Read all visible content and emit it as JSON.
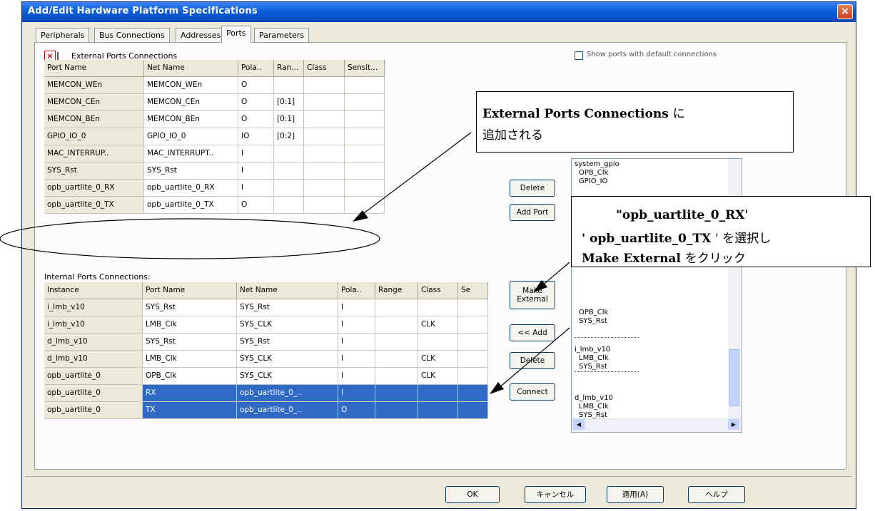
{
  "window": {
    "title": "Add/Edit Hardware Platform Specifications",
    "close_glyph": "×"
  },
  "tabs": [
    "Peripherals",
    "Bus Connections",
    "Addresses",
    "Ports",
    "Parameters"
  ],
  "active_tab": "Ports",
  "external": {
    "label": "External Ports Connections",
    "columns": [
      "Port Name",
      "Net Name",
      "Pola..",
      "Ran...",
      "Class",
      "Sensit..."
    ],
    "rows": [
      [
        "MEMCON_WEn",
        "MEMCON_WEn",
        "O",
        "",
        "",
        ""
      ],
      [
        "MEMCON_CEn",
        "MEMCON_CEn",
        "O",
        "[0:1]",
        "",
        ""
      ],
      [
        "MEMCON_BEn",
        "MEMCON_BEn",
        "O",
        "[0:1]",
        "",
        ""
      ],
      [
        "GPIO_IO_0",
        "GPIO_IO_0",
        "IO",
        "[0:2]",
        "",
        ""
      ],
      [
        "MAC_INTERRUP..",
        "MAC_INTERRUPT..",
        "I",
        "",
        "",
        ""
      ],
      [
        "SYS_Rst",
        "SYS_Rst",
        "I",
        "",
        "",
        ""
      ],
      [
        "opb_uartlite_0_RX",
        "opb_uartlite_0_RX",
        "I",
        "",
        "",
        ""
      ],
      [
        "opb_uartlite_0_TX",
        "opb_uartlite_0_TX",
        "O",
        "",
        "",
        ""
      ]
    ]
  },
  "internal": {
    "label": "Internal Ports Connections:",
    "columns": [
      "Instance",
      "Port Name",
      "Net Name",
      "Pola..",
      "Range",
      "Class",
      "Se"
    ],
    "rows": [
      [
        "i_lmb_v10",
        "SYS_Rst",
        "SYS_Rst",
        "I",
        "",
        ""
      ],
      [
        "i_lmb_v10",
        "LMB_Clk",
        "SYS_CLK",
        "I",
        "",
        "CLK"
      ],
      [
        "d_lmb_v10",
        "SYS_Rst",
        "SYS_Rst",
        "I",
        "",
        ""
      ],
      [
        "d_lmb_v10",
        "LMB_Clk",
        "SYS_CLK",
        "I",
        "",
        "CLK"
      ],
      [
        "opb_uartlite_0",
        "OPB_Clk",
        "SYS_CLK",
        "I",
        "",
        "CLK"
      ],
      [
        "opb_uartlite_0",
        "RX",
        "opb_uartlite_0_..",
        "I",
        "",
        ""
      ],
      [
        "opb_uartlite_0",
        "TX",
        "opb_uartlite_0_..",
        "O",
        "",
        ""
      ]
    ],
    "selected_rows": [
      5,
      6
    ]
  },
  "show_default_checkbox": "Show ports with default connections",
  "buttons": {
    "delete": "Delete",
    "add_port": "Add Port",
    "make_external": "Make\nExternal",
    "add": "<< Add",
    "delete2": "Delete",
    "connect": "Connect"
  },
  "right_list": [
    "system_gpio",
    "OPB_Clk",
    "GPIO_IO",
    "OPB_Clk",
    "SYS_Rst",
    "i_lmb_v10",
    "LMB_Clk",
    "SYS_Rst",
    "d_lmb_v10",
    "LMB_Clk",
    "SYS_Rst"
  ],
  "footer": [
    "OK",
    "キャンセル",
    "適用(A)",
    "ヘルプ"
  ],
  "callouts": {
    "top_line1": "External Ports Connections",
    "top_line1_suffix": "に",
    "top_line2": "追加される",
    "right_line1": "\"opb_uartlite_0_RX",
    "right_line1_suffix": "'",
    "right_line2_prefix": "'",
    "right_line2": "opb_uartlite_0_TX",
    "right_line2_suffix": "' を選択し",
    "right_line3": "Make External",
    "right_line3_suffix": "をクリック"
  }
}
